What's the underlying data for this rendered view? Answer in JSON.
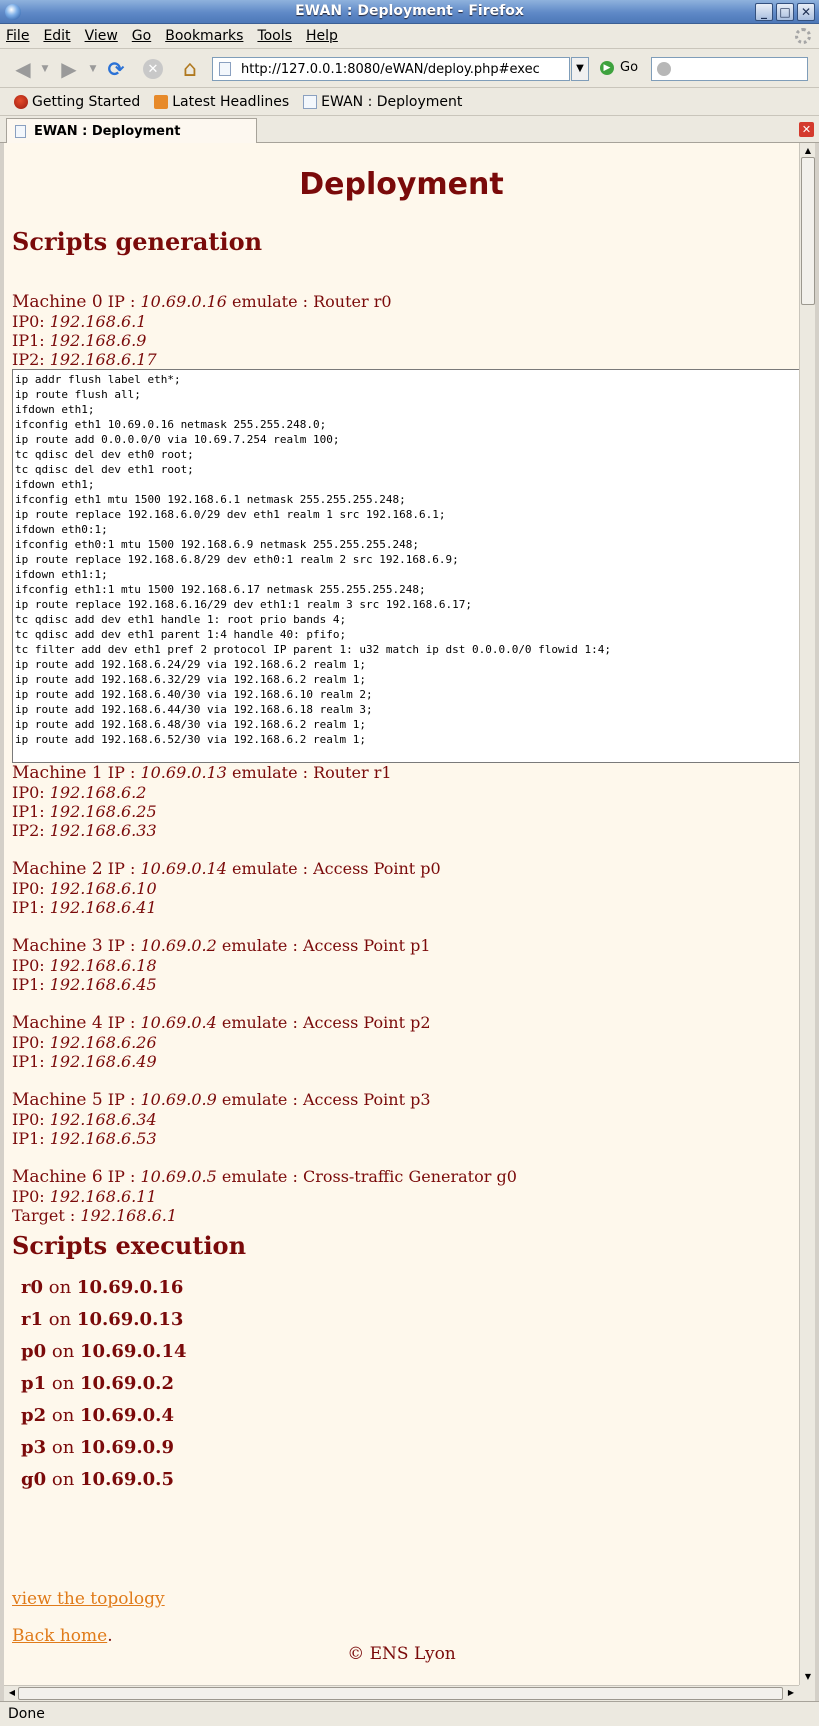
{
  "window": {
    "title": "EWAN : Deployment - Firefox",
    "buttons": [
      "_",
      "□",
      "✕"
    ]
  },
  "menu": [
    "File",
    "Edit",
    "View",
    "Go",
    "Bookmarks",
    "Tools",
    "Help"
  ],
  "toolbar": {
    "url": "http://127.0.0.1:8080/eWAN/deploy.php#exec",
    "go_label": "Go",
    "search_value": ""
  },
  "bookmarks": [
    "Getting Started",
    "Latest Headlines",
    "EWAN : Deployment"
  ],
  "tab": {
    "label": "EWAN : Deployment"
  },
  "page": {
    "title": "Deployment",
    "generation_heading": "Scripts generation",
    "ip_label": "IP :",
    "emulate_label": "emulate :",
    "machines": [
      {
        "name": "Machine 0",
        "ip": "10.69.0.16",
        "emulate": "Router r0",
        "lines": [
          {
            "label": "IP0:",
            "value": "192.168.6.1"
          },
          {
            "label": "IP1:",
            "value": "192.168.6.9"
          },
          {
            "label": "IP2:",
            "value": "192.168.6.17"
          }
        ]
      },
      {
        "name": "Machine 1",
        "ip": "10.69.0.13",
        "emulate": "Router r1",
        "lines": [
          {
            "label": "IP0:",
            "value": "192.168.6.2"
          },
          {
            "label": "IP1:",
            "value": "192.168.6.25"
          },
          {
            "label": "IP2:",
            "value": "192.168.6.33"
          }
        ]
      },
      {
        "name": "Machine 2",
        "ip": "10.69.0.14",
        "emulate": "Access Point p0",
        "lines": [
          {
            "label": "IP0:",
            "value": "192.168.6.10"
          },
          {
            "label": "IP1:",
            "value": "192.168.6.41"
          }
        ]
      },
      {
        "name": "Machine 3",
        "ip": "10.69.0.2",
        "emulate": "Access Point p1",
        "lines": [
          {
            "label": "IP0:",
            "value": "192.168.6.18"
          },
          {
            "label": "IP1:",
            "value": "192.168.6.45"
          }
        ]
      },
      {
        "name": "Machine 4",
        "ip": "10.69.0.4",
        "emulate": "Access Point p2",
        "lines": [
          {
            "label": "IP0:",
            "value": "192.168.6.26"
          },
          {
            "label": "IP1:",
            "value": "192.168.6.49"
          }
        ]
      },
      {
        "name": "Machine 5",
        "ip": "10.69.0.9",
        "emulate": "Access Point p3",
        "lines": [
          {
            "label": "IP0:",
            "value": "192.168.6.34"
          },
          {
            "label": "IP1:",
            "value": "192.168.6.53"
          }
        ]
      },
      {
        "name": "Machine 6",
        "ip": "10.69.0.5",
        "emulate": "Cross-traffic Generator g0",
        "lines": [
          {
            "label": "IP0:",
            "value": "192.168.6.11"
          },
          {
            "label": "Target :",
            "value": "192.168.6.1"
          }
        ]
      }
    ],
    "script_r0": "ip addr flush label eth*;\nip route flush all;\nifdown eth1;\nifconfig eth1 10.69.0.16 netmask 255.255.248.0;\nip route add 0.0.0.0/0 via 10.69.7.254 realm 100;\ntc qdisc del dev eth0 root;\ntc qdisc del dev eth1 root;\nifdown eth1;\nifconfig eth1 mtu 1500 192.168.6.1 netmask 255.255.255.248;\nip route replace 192.168.6.0/29 dev eth1 realm 1 src 192.168.6.1;\nifdown eth0:1;\nifconfig eth0:1 mtu 1500 192.168.6.9 netmask 255.255.255.248;\nip route replace 192.168.6.8/29 dev eth0:1 realm 2 src 192.168.6.9;\nifdown eth1:1;\nifconfig eth1:1 mtu 1500 192.168.6.17 netmask 255.255.255.248;\nip route replace 192.168.6.16/29 dev eth1:1 realm 3 src 192.168.6.17;\ntc qdisc add dev eth1 handle 1: root prio bands 4;\ntc qdisc add dev eth1 parent 1:4 handle 40: pfifo;\ntc filter add dev eth1 pref 2 protocol IP parent 1: u32 match ip dst 0.0.0.0/0 flowid 1:4;\nip route add 192.168.6.24/29 via 192.168.6.2 realm 1;\nip route add 192.168.6.32/29 via 192.168.6.2 realm 1;\nip route add 192.168.6.40/30 via 192.168.6.10 realm 2;\nip route add 192.168.6.44/30 via 192.168.6.18 realm 3;\nip route add 192.168.6.48/30 via 192.168.6.2 realm 1;\nip route add 192.168.6.52/30 via 192.168.6.2 realm 1;",
    "execution_heading": "Scripts execution",
    "on_word": "on",
    "execution": [
      {
        "node": "r0",
        "ip": "10.69.0.16"
      },
      {
        "node": "r1",
        "ip": "10.69.0.13"
      },
      {
        "node": "p0",
        "ip": "10.69.0.14"
      },
      {
        "node": "p1",
        "ip": "10.69.0.2"
      },
      {
        "node": "p2",
        "ip": "10.69.0.4"
      },
      {
        "node": "p3",
        "ip": "10.69.0.9"
      },
      {
        "node": "g0",
        "ip": "10.69.0.5"
      }
    ],
    "topology_link": "view the topology",
    "home_link": "Back home",
    "home_suffix": ".",
    "footer": "© ENS Lyon"
  },
  "status": "Done"
}
